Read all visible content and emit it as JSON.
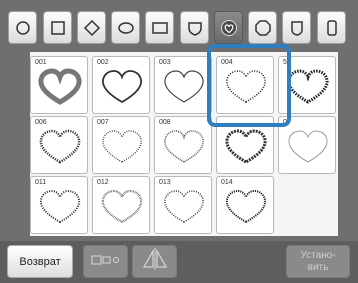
{
  "shape_tabs": [
    {
      "name": "circle",
      "selected": false
    },
    {
      "name": "square",
      "selected": false
    },
    {
      "name": "diamond",
      "selected": false
    },
    {
      "name": "ellipse",
      "selected": false
    },
    {
      "name": "rectangle",
      "selected": false
    },
    {
      "name": "shield",
      "selected": false
    },
    {
      "name": "heart",
      "selected": true
    },
    {
      "name": "octagon",
      "selected": false
    },
    {
      "name": "badge",
      "selected": false
    },
    {
      "name": "rounded-rectangle",
      "selected": false
    }
  ],
  "patterns": [
    {
      "number": "001",
      "selected": false
    },
    {
      "number": "002",
      "selected": false
    },
    {
      "number": "003",
      "selected": false
    },
    {
      "number": "004",
      "selected": true
    },
    {
      "number": "5",
      "selected": false
    },
    {
      "number": "006",
      "selected": false
    },
    {
      "number": "007",
      "selected": false
    },
    {
      "number": "008",
      "selected": false
    },
    {
      "number": "",
      "selected": false
    },
    {
      "number": "0",
      "selected": false
    },
    {
      "number": "011",
      "selected": false
    },
    {
      "number": "012",
      "selected": false
    },
    {
      "number": "013",
      "selected": false
    },
    {
      "number": "014",
      "selected": false
    }
  ],
  "buttons": {
    "back": "Возврат",
    "set": "Устано-\nвить"
  },
  "icons": {
    "layout": "frame-layout-icon",
    "mirror": "mirror-icon"
  },
  "colors": {
    "selection": "#2d7fc0"
  }
}
